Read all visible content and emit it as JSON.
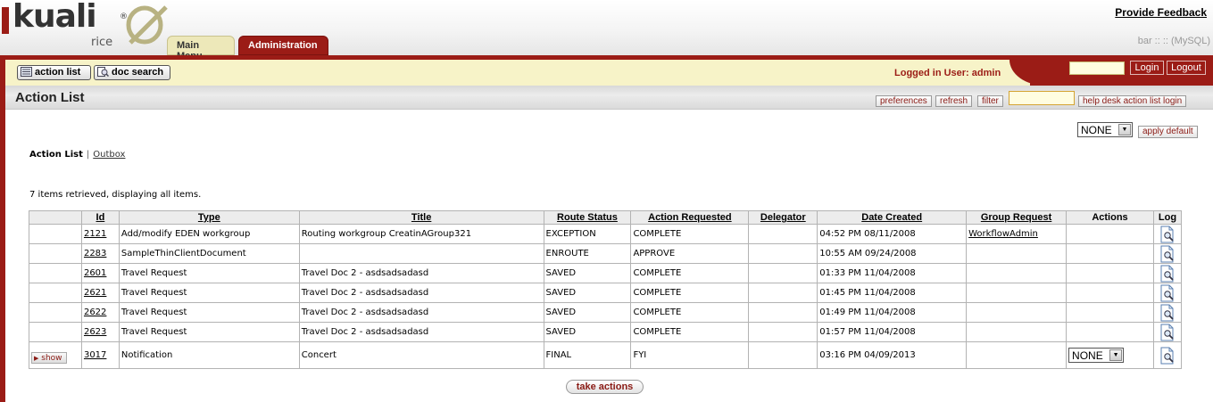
{
  "header": {
    "logo_text": "kuali",
    "logo_sub": "rice",
    "provide_feedback": "Provide Feedback",
    "server_info": "bar :: :: (MySQL)",
    "tabs": [
      {
        "label": "Main Menu",
        "active": false
      },
      {
        "label": "Administration",
        "active": true
      }
    ]
  },
  "toolbar": {
    "action_list_label": "action list",
    "doc_search_label": "doc search",
    "logged_in": "Logged in User: admin",
    "login_label": "Login",
    "logout_label": "Logout"
  },
  "titlebar": {
    "title": "Action List",
    "preferences_label": "preferences",
    "refresh_label": "refresh",
    "filter_label": "filter",
    "help_desk_label": "help desk action list login"
  },
  "main": {
    "default_select_value": "NONE",
    "apply_default_label": "apply default",
    "subnav_current": "Action List",
    "subnav_separator": "|",
    "subnav_outbox": "Outbox",
    "items_message": "7 items retrieved, displaying all items.",
    "take_actions_label": "take actions"
  },
  "table": {
    "headers": {
      "id": "Id",
      "type": "Type",
      "title": "Title",
      "route_status": "Route Status",
      "action_requested": "Action Requested",
      "delegator": "Delegator",
      "date_created": "Date Created",
      "group_request": "Group Request",
      "actions": "Actions",
      "log": "Log"
    },
    "rows": [
      {
        "id": "2121",
        "type": "Add/modify EDEN workgroup",
        "title": "Routing workgroup CreatinAGroup321",
        "route_status": "EXCEPTION",
        "action_requested": "COMPLETE",
        "delegator": "",
        "date_created": "04:52 PM 08/11/2008",
        "group_request": "WorkflowAdmin",
        "actions": "",
        "show": ""
      },
      {
        "id": "2283",
        "type": "SampleThinClientDocument",
        "title": "",
        "route_status": "ENROUTE",
        "action_requested": "APPROVE",
        "delegator": "",
        "date_created": "10:55 AM 09/24/2008",
        "group_request": "",
        "actions": "",
        "show": ""
      },
      {
        "id": "2601",
        "type": "Travel Request",
        "title": "Travel Doc 2 - asdsadsadasd",
        "route_status": "SAVED",
        "action_requested": "COMPLETE",
        "delegator": "",
        "date_created": "01:33 PM 11/04/2008",
        "group_request": "",
        "actions": "",
        "show": ""
      },
      {
        "id": "2621",
        "type": "Travel Request",
        "title": "Travel Doc 2 - asdsadsadasd",
        "route_status": "SAVED",
        "action_requested": "COMPLETE",
        "delegator": "",
        "date_created": "01:45 PM 11/04/2008",
        "group_request": "",
        "actions": "",
        "show": ""
      },
      {
        "id": "2622",
        "type": "Travel Request",
        "title": "Travel Doc 2 - asdsadsadasd",
        "route_status": "SAVED",
        "action_requested": "COMPLETE",
        "delegator": "",
        "date_created": "01:49 PM 11/04/2008",
        "group_request": "",
        "actions": "",
        "show": ""
      },
      {
        "id": "2623",
        "type": "Travel Request",
        "title": "Travel Doc 2 - asdsadsadasd",
        "route_status": "SAVED",
        "action_requested": "COMPLETE",
        "delegator": "",
        "date_created": "01:57 PM 11/04/2008",
        "group_request": "",
        "actions": "",
        "show": ""
      },
      {
        "id": "3017",
        "type": "Notification",
        "title": "Concert",
        "route_status": "FINAL",
        "action_requested": "FYI",
        "delegator": "",
        "date_created": "03:16 PM 04/09/2013",
        "group_request": "",
        "actions": "NONE",
        "show": "show"
      }
    ]
  },
  "icons": {
    "action_list": "action-list-icon",
    "doc_search": "doc-search-icon",
    "log": "log-document-magnifier-icon",
    "show": "triangle-right-icon",
    "select_arrow": "chevron-down-icon"
  },
  "colors": {
    "brand_red": "#9b1c16",
    "toolbar_yellow": "#f7f3c8",
    "main_menu_tab": "#ede8b9",
    "logo_mark": "#b8b282"
  }
}
